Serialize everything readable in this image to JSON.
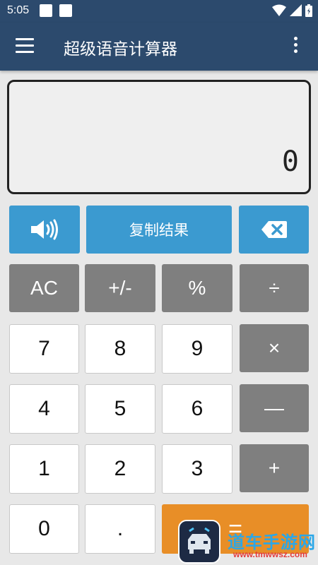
{
  "status": {
    "time": "5:05"
  },
  "app": {
    "title": "超级语音计算器"
  },
  "display": {
    "value": "0"
  },
  "controls": {
    "speaker_icon": "speaker-icon",
    "copy_label": "复制结果",
    "backspace_icon": "backspace-icon"
  },
  "keys": {
    "ac": "AC",
    "plus_minus": "+/-",
    "percent": "%",
    "divide": "÷",
    "seven": "7",
    "eight": "8",
    "nine": "9",
    "multiply": "×",
    "four": "4",
    "five": "5",
    "six": "6",
    "minus": "—",
    "one": "1",
    "two": "2",
    "three": "3",
    "plus": "+",
    "zero": "0",
    "dot": ".",
    "equals": "="
  },
  "watermark": {
    "text": "道车手游网",
    "url": "www.tmwwsz.com"
  },
  "colors": {
    "appbar": "#2c4a6d",
    "accent_blue": "#3b9ad0",
    "operator_gray": "#7f7f7f",
    "equals_orange": "#e88e27"
  }
}
